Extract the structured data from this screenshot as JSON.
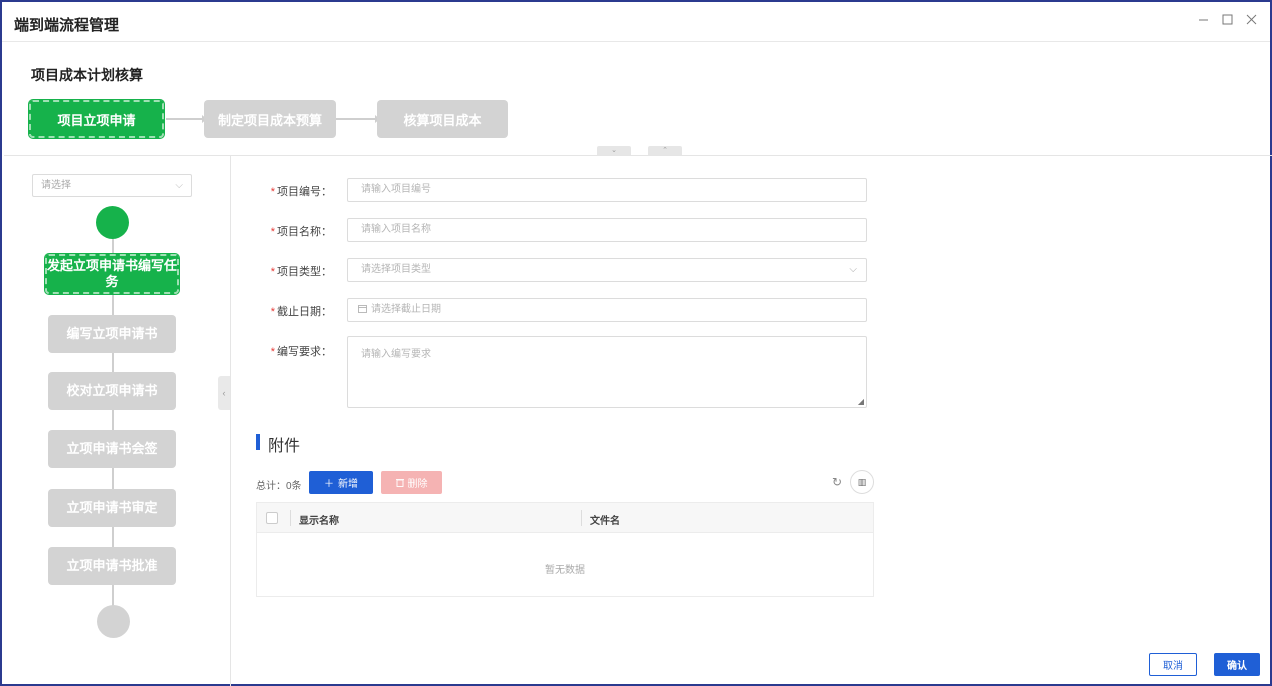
{
  "window": {
    "title": "端到端流程管理",
    "minimize_icon": "minimize-icon",
    "maximize_icon": "maximize-icon",
    "close_icon": "close-icon"
  },
  "section_title": "项目成本计划核算",
  "stepper": {
    "steps": [
      {
        "label": "项目立项申请",
        "state": "active"
      },
      {
        "label": "制定项目成本预算",
        "state": "todo"
      },
      {
        "label": "核算项目成本",
        "state": "todo"
      }
    ]
  },
  "left_panel": {
    "select_placeholder": "请选择",
    "nodes": [
      {
        "label": "发起立项申请书编写任务",
        "state": "active"
      },
      {
        "label": "编写立项申请书",
        "state": "todo"
      },
      {
        "label": "校对立项申请书",
        "state": "todo"
      },
      {
        "label": "立项申请书会签",
        "state": "todo"
      },
      {
        "label": "立项申请书审定",
        "state": "todo"
      },
      {
        "label": "立项申请书批准",
        "state": "todo"
      }
    ]
  },
  "form": {
    "required_mark": "*",
    "fields": [
      {
        "label": "项目编号：",
        "placeholder": "请输入项目编号"
      },
      {
        "label": "项目名称：",
        "placeholder": "请输入项目名称"
      },
      {
        "label": "项目类型：",
        "placeholder": "请选择项目类型"
      },
      {
        "label": "截止日期：",
        "placeholder": "请选择截止日期"
      },
      {
        "label": "编写要求：",
        "placeholder": "请输入编写要求"
      }
    ]
  },
  "attachments": {
    "title": "附件",
    "total": "总计：0条",
    "add_label": "新增",
    "delete_label": "删除",
    "columns": [
      "显示名称",
      "文件名"
    ],
    "empty_text": "暂无数据"
  },
  "footer": {
    "cancel_label": "取消",
    "ok_label": "确认"
  },
  "colors": {
    "active_green": "#16b24b",
    "primary_blue": "#1f5fd6",
    "inactive_gray": "#d3d3d3"
  }
}
